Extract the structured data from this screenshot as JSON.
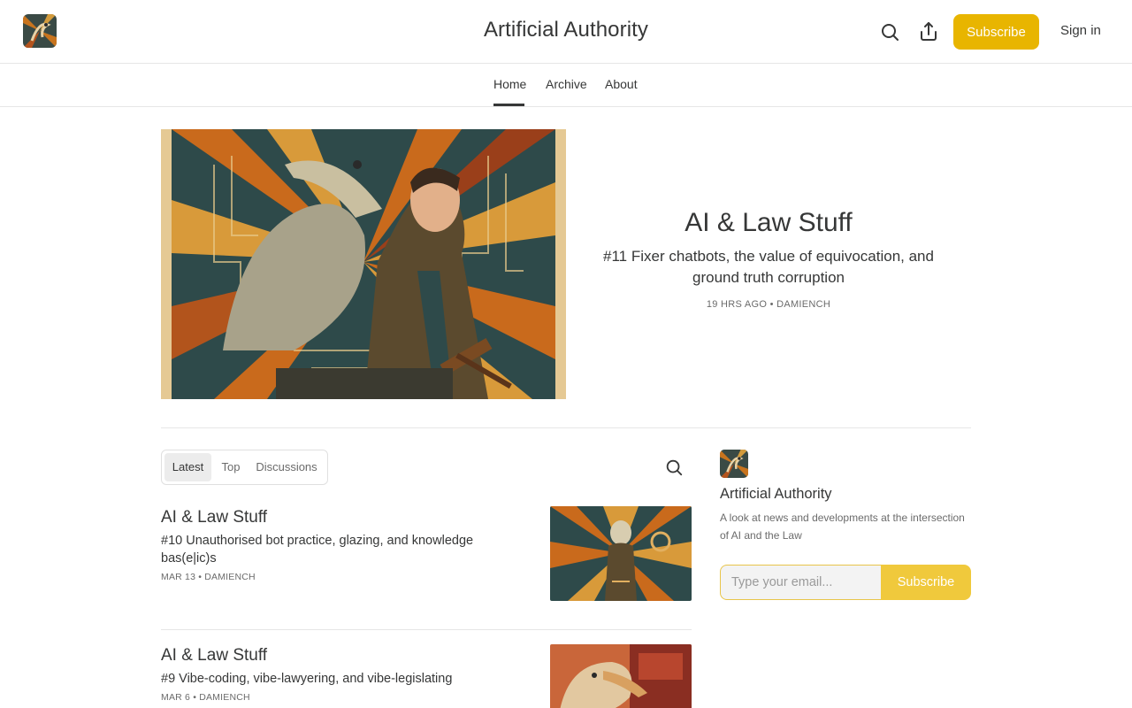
{
  "header": {
    "title": "Artificial Authority",
    "logo_icon": "publication-logo",
    "search_icon": "search-icon",
    "share_icon": "share-icon",
    "subscribe_label": "Subscribe",
    "signin_label": "Sign in"
  },
  "nav": {
    "items": [
      {
        "label": "Home",
        "active": true
      },
      {
        "label": "Archive",
        "active": false
      },
      {
        "label": "About",
        "active": false
      }
    ]
  },
  "hero": {
    "title": "AI & Law Stuff",
    "subtitle": "#11 Fixer chatbots, the value of equivocation, and ground truth corruption",
    "meta": "19 HRS AGO • DAMIENCH"
  },
  "tabs": [
    {
      "label": "Latest",
      "active": true
    },
    {
      "label": "Top",
      "active": false
    },
    {
      "label": "Discussions",
      "active": false
    }
  ],
  "posts": [
    {
      "title": "AI & Law Stuff",
      "subtitle": "#10 Unauthorised bot practice, glazing, and knowledge bas(e|ic)s",
      "meta": "MAR 13 • DAMIENCH"
    },
    {
      "title": "AI & Law Stuff",
      "subtitle": "#9 Vibe-coding, vibe-lawyering, and vibe-legislating",
      "meta": "MAR 6 • DAMIENCH"
    }
  ],
  "sidebar": {
    "title": "Artificial Authority",
    "description": "A look at news and developments at the intersection of AI and the Law",
    "email_placeholder": "Type your email...",
    "subscribe_label": "Subscribe"
  },
  "colors": {
    "accent": "#e8b500",
    "accent_light": "#f0c93c",
    "text": "#363737",
    "muted": "#6b6b6b"
  }
}
